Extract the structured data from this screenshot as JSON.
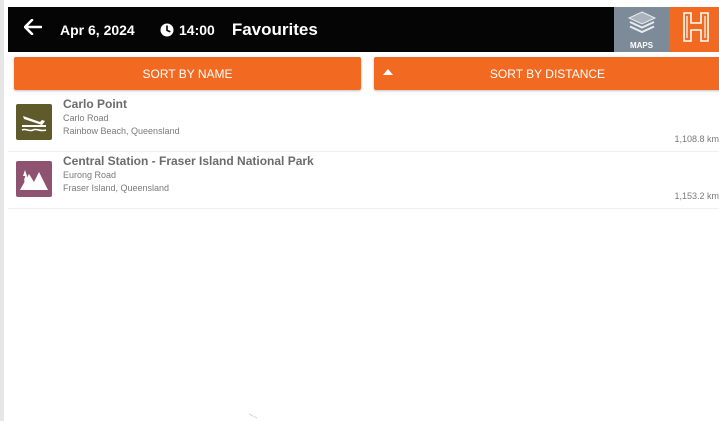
{
  "header": {
    "date": "Apr 6, 2024",
    "time": "14:00",
    "title": "Favourites",
    "maps_label": "MAPS",
    "back_icon": "arrow-left-icon",
    "clock_icon": "clock-icon",
    "brand_icon": "hipcamp-h-logo",
    "colors": {
      "bar": "#050505",
      "maps_bg": "#7d8a98",
      "brand_bg": "#f26a21"
    }
  },
  "sort": {
    "by_name_label": "SORT BY NAME",
    "by_distance_label": "SORT BY DISTANCE",
    "active_indicator_icon": "caret-up-icon",
    "accent": "#f26a21"
  },
  "favourites": [
    {
      "name": "Carlo Point",
      "road": "Carlo Road",
      "region": "Rainbow Beach, Queensland",
      "distance": "1,108.8 km",
      "icon": "boat-ramp-icon",
      "icon_color": "#5f5a2a"
    },
    {
      "name": "Central Station - Fraser Island National Park",
      "road": "Eurong Road",
      "region": "Fraser Island, Queensland",
      "distance": "1,153.2 km",
      "icon": "national-park-icon",
      "icon_color": "#8e5370"
    }
  ]
}
